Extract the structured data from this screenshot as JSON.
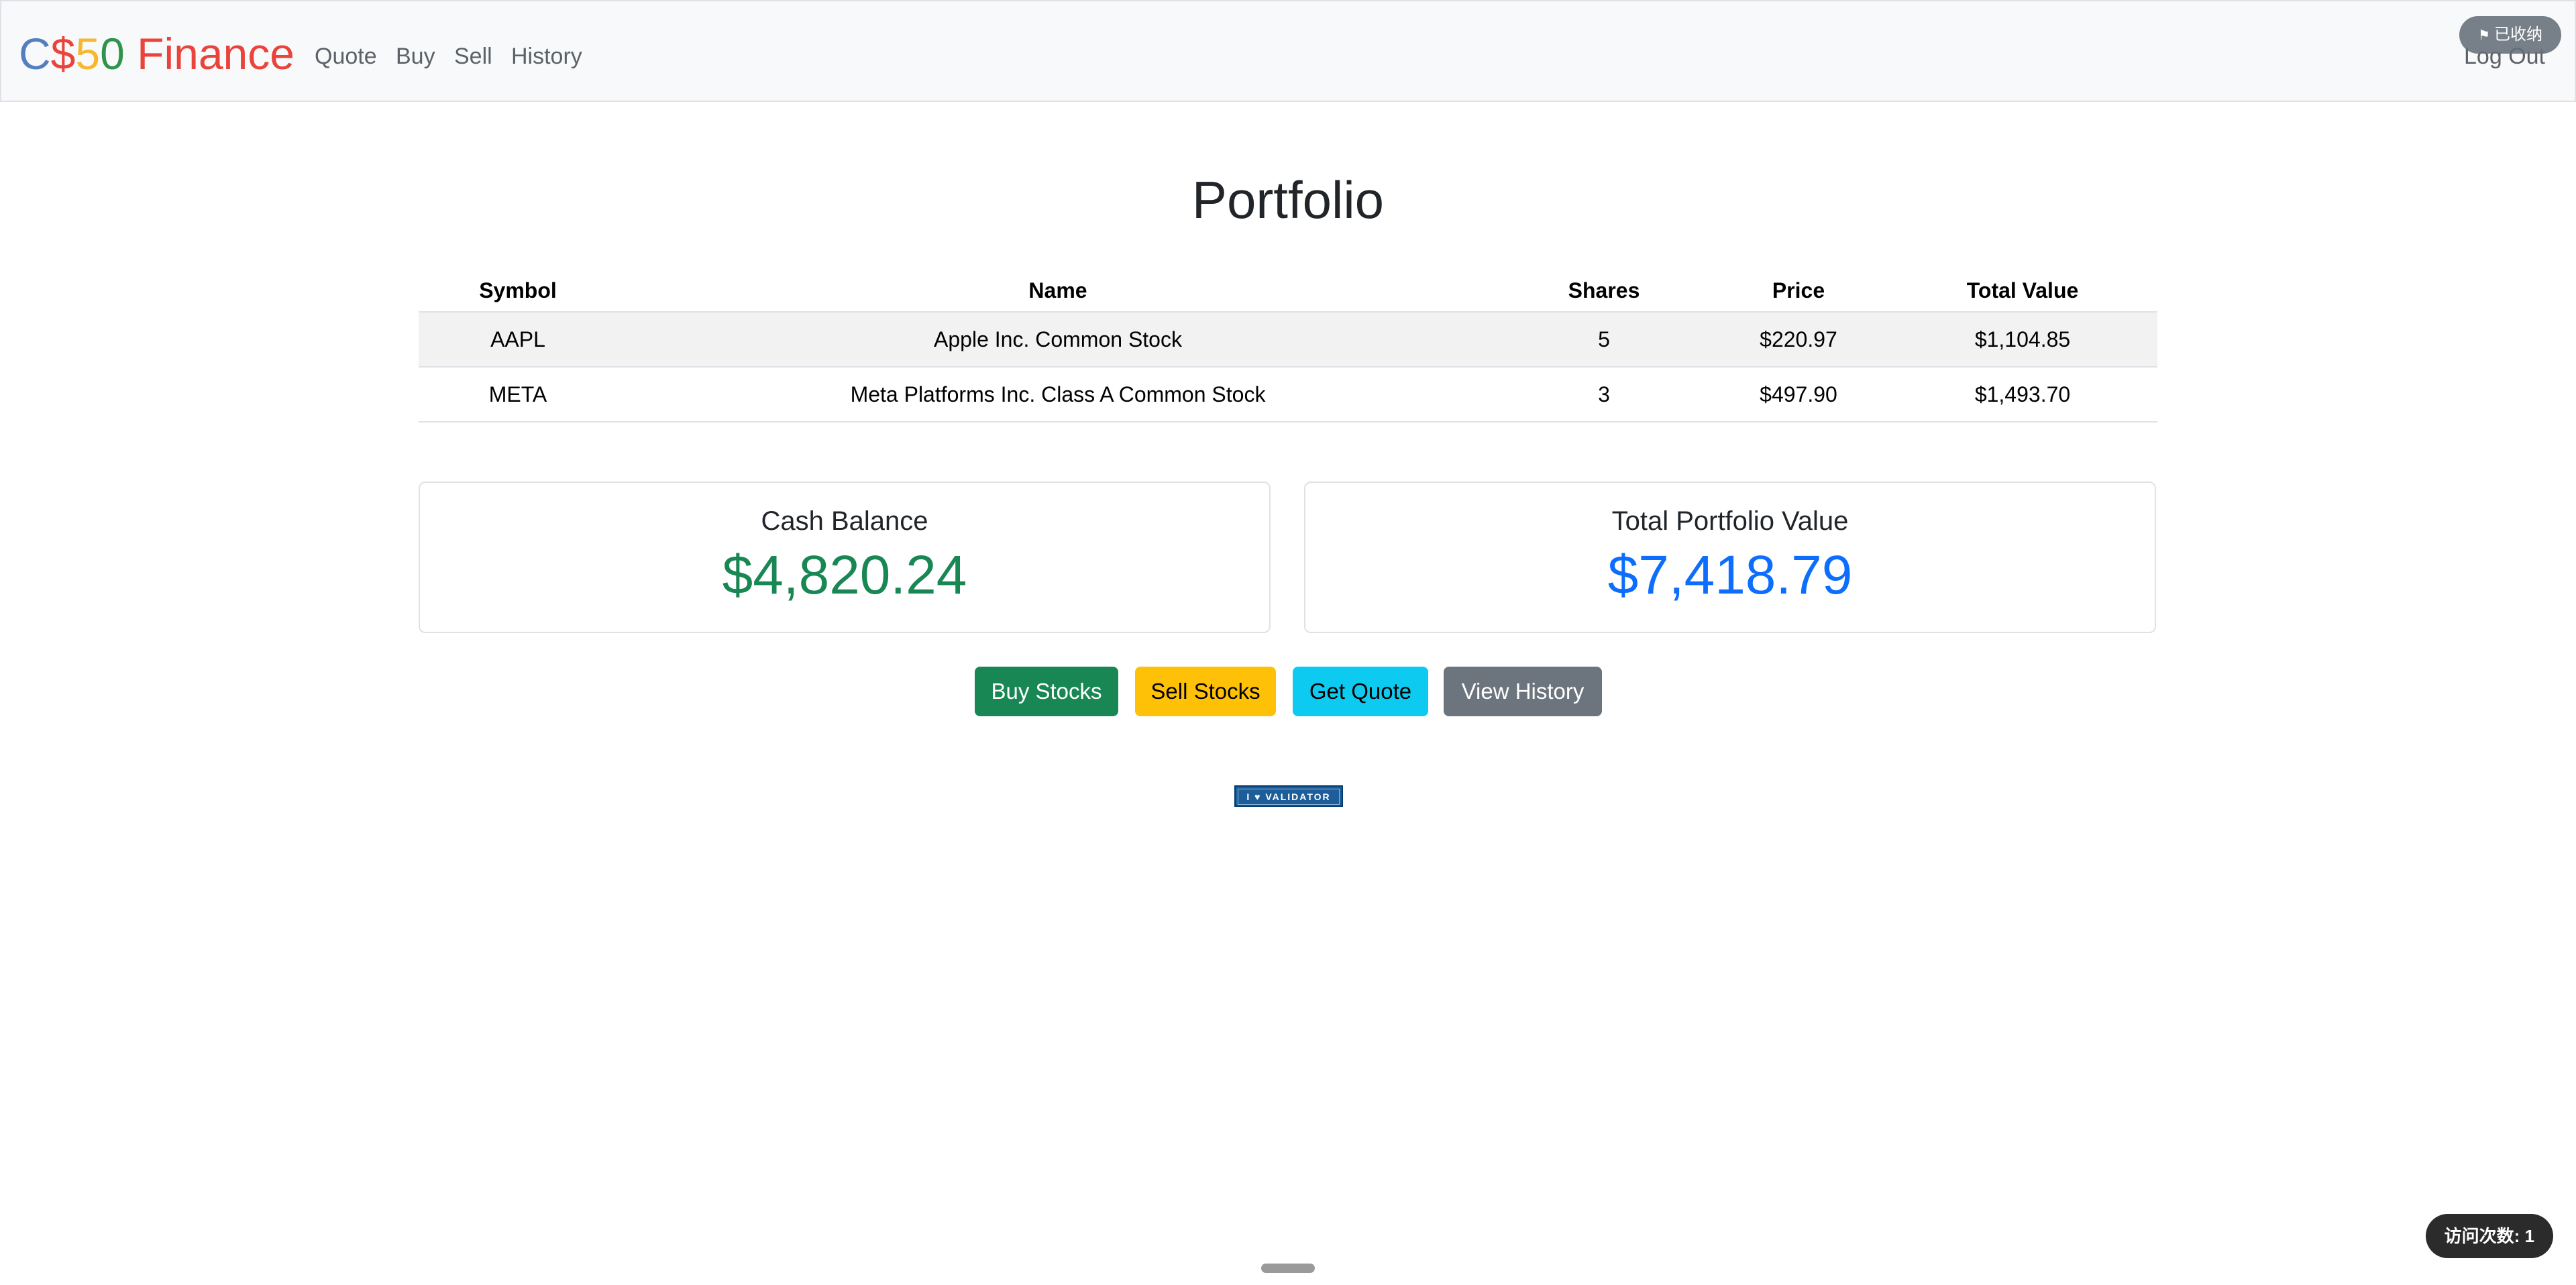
{
  "navbar": {
    "brand": {
      "parts": [
        {
          "text": "C",
          "color": "#537fbe"
        },
        {
          "text": "$",
          "color": "#ea433b"
        },
        {
          "text": "5",
          "color": "#f5b82e"
        },
        {
          "text": "0",
          "color": "#2e944b"
        },
        {
          "text": " Finance",
          "color": "#ea433b"
        }
      ]
    },
    "links": [
      "Quote",
      "Buy",
      "Sell",
      "History"
    ],
    "logout_label": "Log Out",
    "collapse_pill_label": "已收纳"
  },
  "main": {
    "title": "Portfolio",
    "table": {
      "headers": [
        "Symbol",
        "Name",
        "Shares",
        "Price",
        "Total Value"
      ],
      "rows": [
        [
          "AAPL",
          "Apple Inc. Common Stock",
          "5",
          "$220.97",
          "$1,104.85"
        ],
        [
          "META",
          "Meta Platforms Inc. Class A Common Stock",
          "3",
          "$497.90",
          "$1,493.70"
        ]
      ]
    },
    "cash_card": {
      "label": "Cash Balance",
      "value": "$4,820.24",
      "value_color": "#198754"
    },
    "total_card": {
      "label": "Total Portfolio Value",
      "value": "$7,418.79",
      "value_color": "#0d6efd"
    },
    "buttons": {
      "buy": "Buy Stocks",
      "sell": "Sell Stocks",
      "quote": "Get Quote",
      "history": "View History"
    },
    "validator_badge": "I ♥ VALIDATOR"
  },
  "visit_counter": "访问次数: 1"
}
